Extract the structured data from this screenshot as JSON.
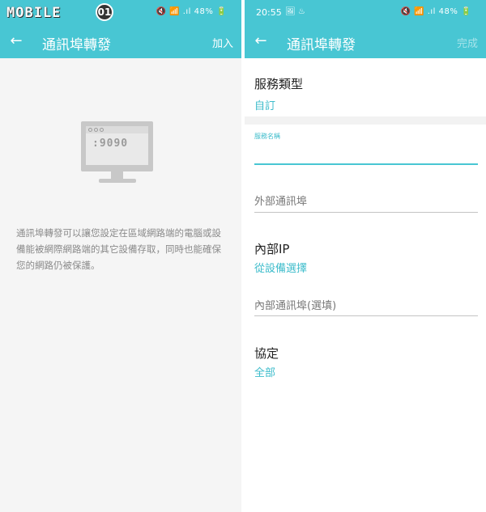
{
  "left": {
    "status": {
      "logo": "MOBILE",
      "logo_badge": "01",
      "icons": "🔇 📶 .ıl 48% 🔋"
    },
    "appbar": {
      "back_icon": "←",
      "title": "通訊埠轉發",
      "action": "加入"
    },
    "illustration": {
      "port": ":9090"
    },
    "description": "通訊埠轉發可以讓您設定在區域網路端的電腦或設備能被網際網路端的其它設備存取，同時也能確保您的網路仍被保護。"
  },
  "right": {
    "status": {
      "time": "20:55",
      "left_icons": "🖼 ♨",
      "icons": "🔇 📶 .ıl 48% 🔋"
    },
    "appbar": {
      "back_icon": "←",
      "title": "通訊埠轉發",
      "action": "完成"
    },
    "service_type": {
      "label": "服務類型",
      "value": "自訂"
    },
    "service_name": {
      "label": "服務名稱",
      "value": ""
    },
    "external_port": {
      "placeholder": "外部通訊埠"
    },
    "internal_ip": {
      "label": "內部IP",
      "value": "從設備選擇"
    },
    "internal_port": {
      "placeholder": "內部通訊埠(選填)"
    },
    "protocol": {
      "label": "協定",
      "value": "全部"
    }
  },
  "colors": {
    "accent": "#48c6d3",
    "link": "#3dbccb"
  }
}
